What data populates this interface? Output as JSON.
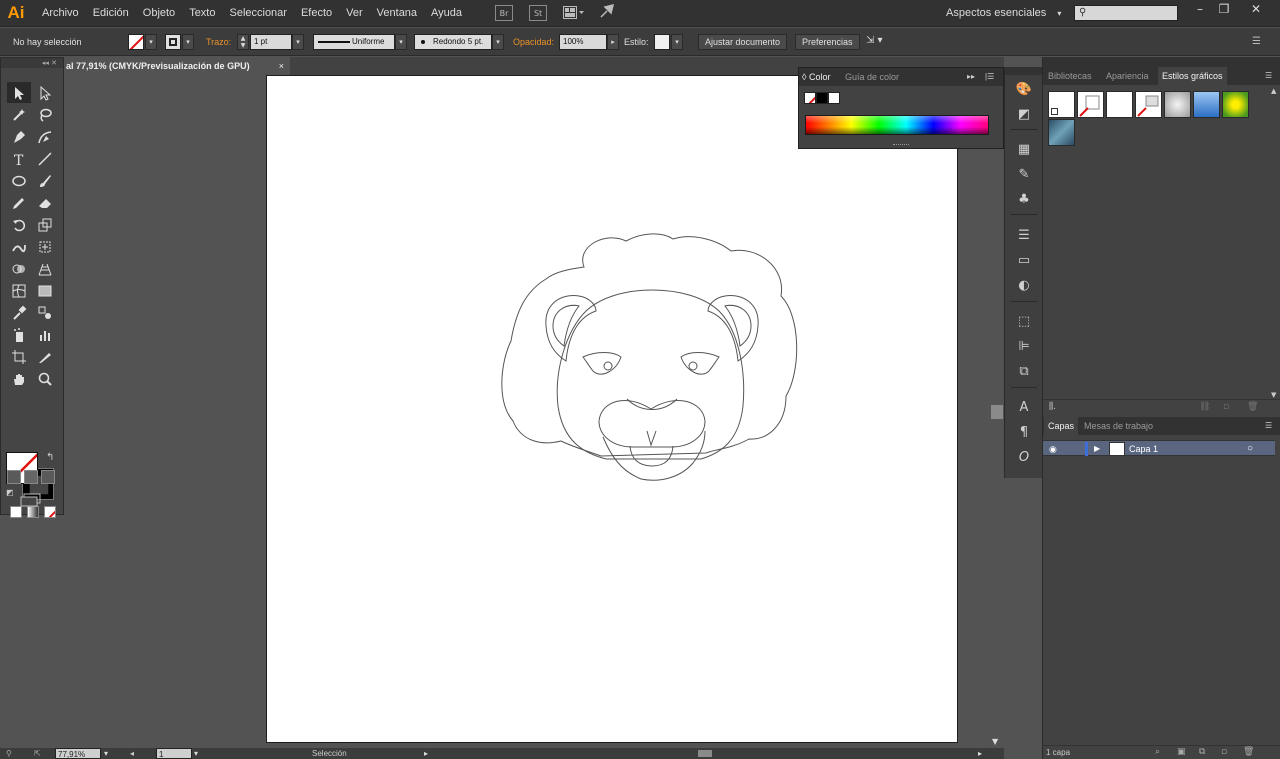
{
  "app": {
    "logo": "Ai",
    "menu": [
      "Archivo",
      "Edición",
      "Objeto",
      "Texto",
      "Seleccionar",
      "Efecto",
      "Ver",
      "Ventana",
      "Ayuda"
    ],
    "menu_icons": [
      "Br",
      "St"
    ],
    "workspace": "Aspectos esenciales",
    "window_controls": [
      "–",
      "❐",
      "✕"
    ]
  },
  "control_bar": {
    "selection_status": "No hay selección",
    "stroke_label": "Trazo:",
    "stroke_weight": "1 pt",
    "profile": "Uniforme",
    "brush": "Redondo 5 pt.",
    "opacity_label": "Opacidad:",
    "opacity": "100%",
    "style_label": "Estilo:",
    "doc_setup_button": "Ajustar documento",
    "prefs_button": "Preferencias"
  },
  "document": {
    "tab_title": "al 77,91% (CMYK/Previsualización de GPU)",
    "tab_close": "×"
  },
  "status_bar": {
    "zoom": "77,91%",
    "artboard_num": "1",
    "tool_name": "Selección"
  },
  "color_panel": {
    "tab_active": "Color",
    "tab_inactive": "Guía de color"
  },
  "right_panels": {
    "top_tabs": [
      "Bibliotecas",
      "Apariencia",
      "Estilos gráficos"
    ],
    "layers_tabs": [
      "Capas",
      "Mesas de trabajo"
    ],
    "layer_name": "Capa 1",
    "layers_count": "1 capa"
  },
  "colors": {
    "accent": "#ff9a00",
    "panel_bg": "#424242",
    "layer_highlight": "#5a6680",
    "artboard": "#ffffff"
  },
  "icons": {
    "tools": [
      "selection-tool-icon",
      "direct-selection-tool-icon",
      "magic-wand-tool-icon",
      "lasso-tool-icon",
      "pen-tool-icon",
      "curvature-tool-icon",
      "type-tool-icon",
      "line-tool-icon",
      "ellipse-tool-icon",
      "paintbrush-tool-icon",
      "pencil-tool-icon",
      "eraser-tool-icon",
      "rotate-tool-icon",
      "scale-tool-icon",
      "warp-tool-icon",
      "free-transform-tool-icon",
      "shape-builder-tool-icon",
      "perspective-grid-tool-icon",
      "mesh-tool-icon",
      "gradient-tool-icon",
      "eyedropper-tool-icon",
      "blend-tool-icon",
      "symbol-sprayer-tool-icon",
      "column-graph-tool-icon",
      "artboard-tool-icon",
      "slice-tool-icon",
      "hand-tool-icon",
      "zoom-tool-icon"
    ]
  }
}
